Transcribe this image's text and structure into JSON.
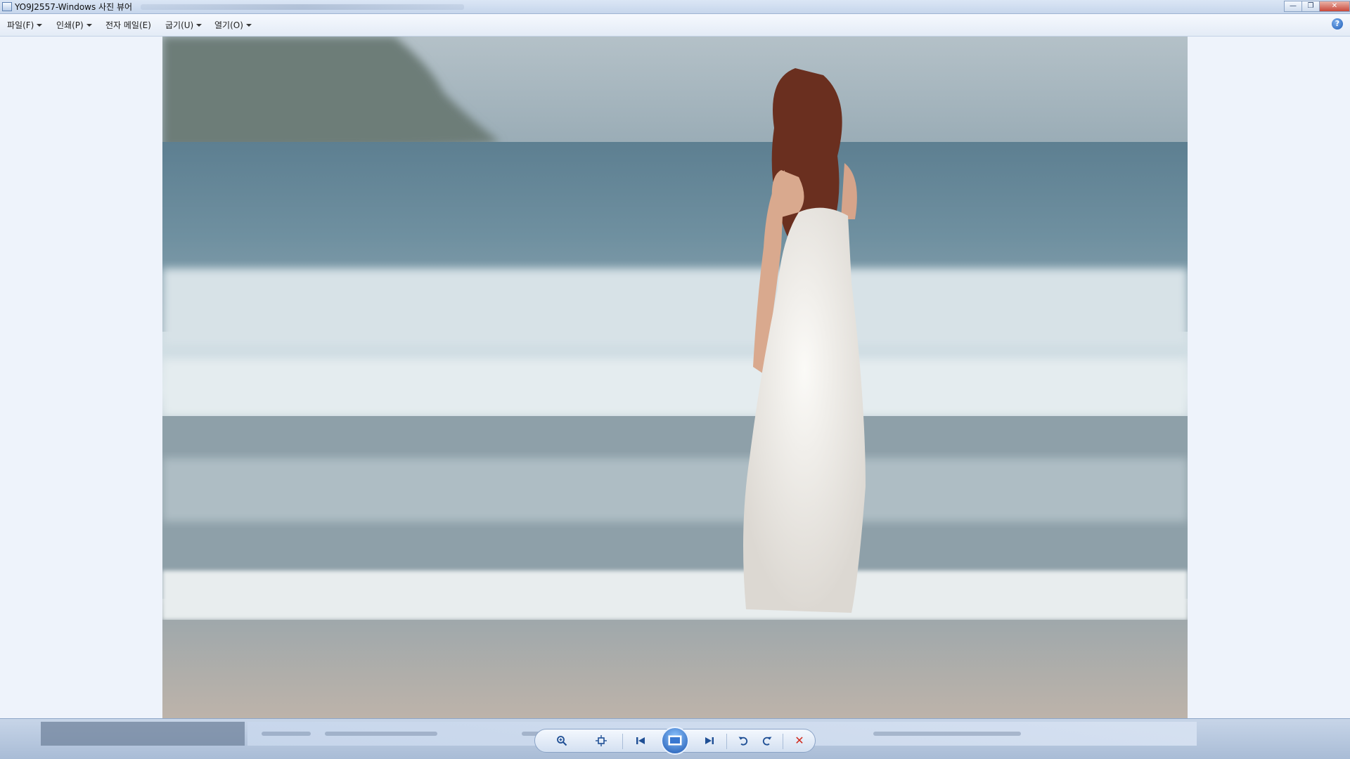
{
  "window": {
    "title": "YO9J2557-Windows 사진 뷰어",
    "controls": {
      "minimize": "—",
      "maximize": "❐",
      "close": "✕"
    }
  },
  "menubar": {
    "items": [
      {
        "label": "파일(F)"
      },
      {
        "label": "인쇄(P)"
      },
      {
        "label": "전자 메일(E)"
      },
      {
        "label": "굽기(U)"
      },
      {
        "label": "열기(O)"
      }
    ],
    "help_label": "?"
  },
  "photo": {
    "description_icon": "photo-beach-woman-white-dress"
  },
  "navbar": {
    "zoom_icon": "zoom-icon",
    "fit_icon": "actual-size-icon",
    "previous_icon": "previous-icon",
    "slideshow_icon": "slideshow-icon",
    "next_icon": "next-icon",
    "rotate_ccw_icon": "rotate-counterclockwise-icon",
    "rotate_cw_icon": "rotate-clockwise-icon",
    "delete_icon": "delete-icon",
    "delete_glyph": "✕"
  },
  "colors": {
    "accent": "#1b55b0",
    "delete": "#d12c1f"
  }
}
